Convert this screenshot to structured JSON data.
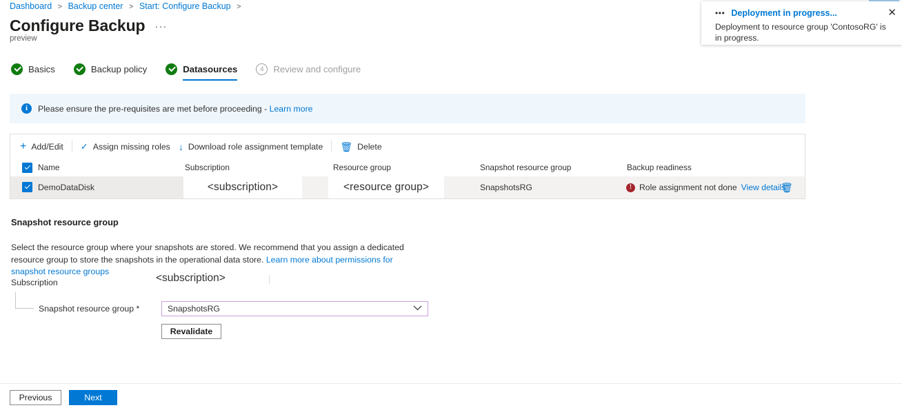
{
  "breadcrumb": {
    "items": [
      "Dashboard",
      "Backup center",
      "Start: Configure Backup"
    ],
    "separator": ">"
  },
  "header": {
    "title": "Configure Backup",
    "ellipsis": "···",
    "preview": "preview"
  },
  "wizard": {
    "steps": [
      {
        "label": "Basics",
        "state": "done"
      },
      {
        "label": "Backup policy",
        "state": "done"
      },
      {
        "label": "Datasources",
        "state": "active-done"
      },
      {
        "label": "Review and configure",
        "state": "pending",
        "number": "4"
      }
    ]
  },
  "banner": {
    "icon": "info-icon",
    "text": "Please ensure the pre-requisites are met before proceeding - ",
    "link": "Learn more"
  },
  "toolbar": {
    "commands": [
      {
        "icon": "plus-icon",
        "glyph": "+",
        "label": "Add/Edit"
      },
      {
        "icon": "check-icon",
        "glyph": "✓",
        "label": "Assign missing roles"
      },
      {
        "icon": "download-icon",
        "glyph": "↓",
        "label": "Download role assignment template"
      },
      {
        "icon": "trash-icon",
        "glyph": "🗑",
        "label": "Delete"
      }
    ]
  },
  "grid": {
    "columns": [
      "Name",
      "Subscription",
      "Resource group",
      "Snapshot resource group",
      "Backup readiness"
    ],
    "rows": [
      {
        "selected": true,
        "name": "DemoDataDisk",
        "subscription": "<subscription>",
        "resource_group": "<resource group>",
        "snapshot_resource_group": "SnapshotsRG",
        "readiness_status": "Role assignment not done",
        "readiness_link": "View details",
        "error_glyph": "!",
        "delete_icon": "🗑"
      }
    ]
  },
  "section": {
    "title": "Snapshot resource group",
    "description": "Select the resource group where your snapshots are stored. We recommend that you assign a dedicated resource group to store the snapshots in the operational data store. ",
    "description_link": "Learn more about permissions for snapshot resource groups"
  },
  "form": {
    "subscription_label": "Subscription",
    "subscription_value": "<subscription>",
    "snapshot_rg_label": "Snapshot resource group *",
    "snapshot_rg_value": "SnapshotsRG",
    "chevron": "⌄",
    "revalidate_label": "Revalidate"
  },
  "footer": {
    "previous_label": "Previous",
    "next_label": "Next"
  },
  "notification": {
    "dots": "•••",
    "title": "Deployment in progress...",
    "body": "Deployment to resource group 'ContosoRG' is in progress.",
    "close": "✕"
  },
  "colors": {
    "accent": "#0078d4",
    "success": "#107c10",
    "error": "#a4262c",
    "banner_bg": "#eff6fc",
    "row_bg": "#f3f2f1",
    "dropdown_border": "#c9a0dc"
  }
}
